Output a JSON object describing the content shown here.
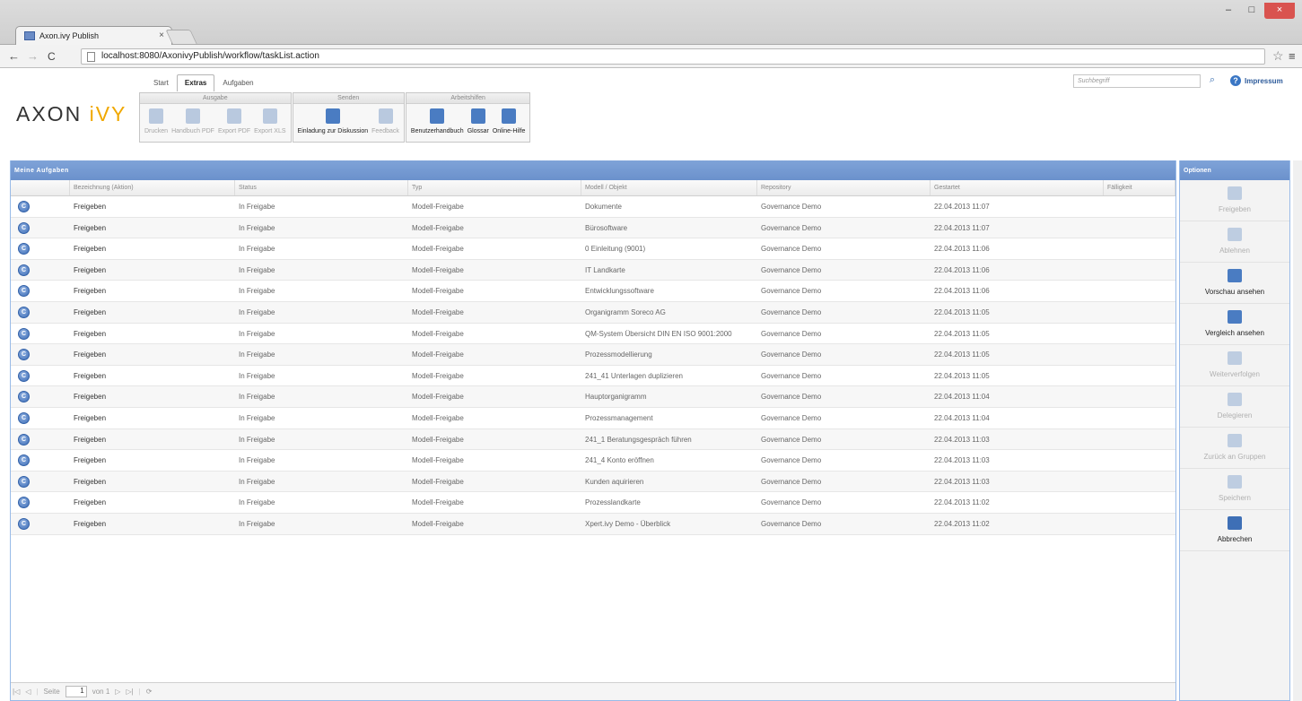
{
  "browser": {
    "tab_title": "Axon.ivy Publish",
    "tab_close": "×",
    "url": "localhost:8080/AxonivyPublish/workflow/taskList.action",
    "win_minimize": "–",
    "win_maximize": "□",
    "win_close": "×"
  },
  "app": {
    "logo_main": "AXON ",
    "logo_accent": "iVY",
    "menu_tabs": [
      "Start",
      "Extras",
      "Aufgaben"
    ],
    "active_tab": "Extras",
    "search_placeholder": "Suchbegriff",
    "impressum": "Impressum"
  },
  "ribbon": {
    "groups": [
      {
        "title": "Ausgabe",
        "buttons": [
          "Drucken",
          "Handbuch PDF",
          "Export PDF",
          "Export XLS"
        ]
      },
      {
        "title": "Senden",
        "buttons": [
          "Einladung zur Diskussion",
          "Feedback"
        ]
      },
      {
        "title": "Arbeitshilfen",
        "buttons": [
          "Benutzerhandbuch",
          "Glossar",
          "Online-Hilfe"
        ]
      }
    ]
  },
  "tasks": {
    "panel_title": "Meine Aufgaben",
    "columns": [
      "",
      "Bezeichnung (Aktion)",
      "Status",
      "Typ",
      "Modell / Objekt",
      "Repository",
      "Gestartet",
      "Fälligkeit"
    ],
    "icon_glyph": "C",
    "rows": [
      {
        "action": "Freigeben",
        "status": "In Freigabe",
        "type": "Modell-Freigabe",
        "object": "Dokumente",
        "repo": "Governance Demo",
        "started": "22.04.2013 11:07",
        "due": ""
      },
      {
        "action": "Freigeben",
        "status": "In Freigabe",
        "type": "Modell-Freigabe",
        "object": "Bürosoftware",
        "repo": "Governance Demo",
        "started": "22.04.2013 11:07",
        "due": ""
      },
      {
        "action": "Freigeben",
        "status": "In Freigabe",
        "type": "Modell-Freigabe",
        "object": "0 Einleitung (9001)",
        "repo": "Governance Demo",
        "started": "22.04.2013 11:06",
        "due": ""
      },
      {
        "action": "Freigeben",
        "status": "In Freigabe",
        "type": "Modell-Freigabe",
        "object": "IT Landkarte",
        "repo": "Governance Demo",
        "started": "22.04.2013 11:06",
        "due": ""
      },
      {
        "action": "Freigeben",
        "status": "In Freigabe",
        "type": "Modell-Freigabe",
        "object": "Entwicklungssoftware",
        "repo": "Governance Demo",
        "started": "22.04.2013 11:06",
        "due": ""
      },
      {
        "action": "Freigeben",
        "status": "In Freigabe",
        "type": "Modell-Freigabe",
        "object": "Organigramm Soreco AG",
        "repo": "Governance Demo",
        "started": "22.04.2013 11:05",
        "due": ""
      },
      {
        "action": "Freigeben",
        "status": "In Freigabe",
        "type": "Modell-Freigabe",
        "object": "QM-System Übersicht DIN EN ISO 9001:2000",
        "repo": "Governance Demo",
        "started": "22.04.2013 11:05",
        "due": ""
      },
      {
        "action": "Freigeben",
        "status": "In Freigabe",
        "type": "Modell-Freigabe",
        "object": "Prozessmodellierung",
        "repo": "Governance Demo",
        "started": "22.04.2013 11:05",
        "due": ""
      },
      {
        "action": "Freigeben",
        "status": "In Freigabe",
        "type": "Modell-Freigabe",
        "object": "241_41 Unterlagen duplizieren",
        "repo": "Governance Demo",
        "started": "22.04.2013 11:05",
        "due": ""
      },
      {
        "action": "Freigeben",
        "status": "In Freigabe",
        "type": "Modell-Freigabe",
        "object": "Hauptorganigramm",
        "repo": "Governance Demo",
        "started": "22.04.2013 11:04",
        "due": ""
      },
      {
        "action": "Freigeben",
        "status": "In Freigabe",
        "type": "Modell-Freigabe",
        "object": "Prozessmanagement",
        "repo": "Governance Demo",
        "started": "22.04.2013 11:04",
        "due": ""
      },
      {
        "action": "Freigeben",
        "status": "In Freigabe",
        "type": "Modell-Freigabe",
        "object": "241_1 Beratungsgespräch führen",
        "repo": "Governance Demo",
        "started": "22.04.2013 11:03",
        "due": ""
      },
      {
        "action": "Freigeben",
        "status": "In Freigabe",
        "type": "Modell-Freigabe",
        "object": "241_4 Konto eröffnen",
        "repo": "Governance Demo",
        "started": "22.04.2013 11:03",
        "due": ""
      },
      {
        "action": "Freigeben",
        "status": "In Freigabe",
        "type": "Modell-Freigabe",
        "object": "Kunden aquirieren",
        "repo": "Governance Demo",
        "started": "22.04.2013 11:03",
        "due": ""
      },
      {
        "action": "Freigeben",
        "status": "In Freigabe",
        "type": "Modell-Freigabe",
        "object": "Prozesslandkarte",
        "repo": "Governance Demo",
        "started": "22.04.2013 11:02",
        "due": ""
      },
      {
        "action": "Freigeben",
        "status": "In Freigabe",
        "type": "Modell-Freigabe",
        "object": "Xpert.ivy Demo - Überblick",
        "repo": "Governance Demo",
        "started": "22.04.2013 11:02",
        "due": ""
      }
    ]
  },
  "pager": {
    "page_label": "Seite",
    "page_value": "1",
    "of_label": "von 1"
  },
  "options": {
    "title": "Optionen",
    "items": [
      {
        "label": "Freigeben",
        "enabled": false,
        "icon": "thumbs-up-icon",
        "color": "#7fa0cc"
      },
      {
        "label": "Ablehnen",
        "enabled": false,
        "icon": "thumbs-down-icon",
        "color": "#7fa0cc"
      },
      {
        "label": "Vorschau ansehen",
        "enabled": true,
        "icon": "preview-icon",
        "color": "#4a7cc2"
      },
      {
        "label": "Vergleich ansehen",
        "enabled": true,
        "icon": "compare-icon",
        "color": "#4a7cc2"
      },
      {
        "label": "Weiterverfolgen",
        "enabled": false,
        "icon": "follow-icon",
        "color": "#7fa0cc"
      },
      {
        "label": "Delegieren",
        "enabled": false,
        "icon": "delegate-icon",
        "color": "#7fa0cc"
      },
      {
        "label": "Zurück an Gruppen",
        "enabled": false,
        "icon": "return-group-icon",
        "color": "#7fa0cc"
      },
      {
        "label": "Speichern",
        "enabled": false,
        "icon": "save-icon",
        "color": "#7fa0cc"
      },
      {
        "label": "Abbrechen",
        "enabled": true,
        "icon": "cancel-icon",
        "color": "#3e6fb6"
      }
    ]
  },
  "colors": {
    "panel_header": "#6b91cc",
    "logo_accent": "#f0a800",
    "icon_blue": "#4a7cc2"
  }
}
